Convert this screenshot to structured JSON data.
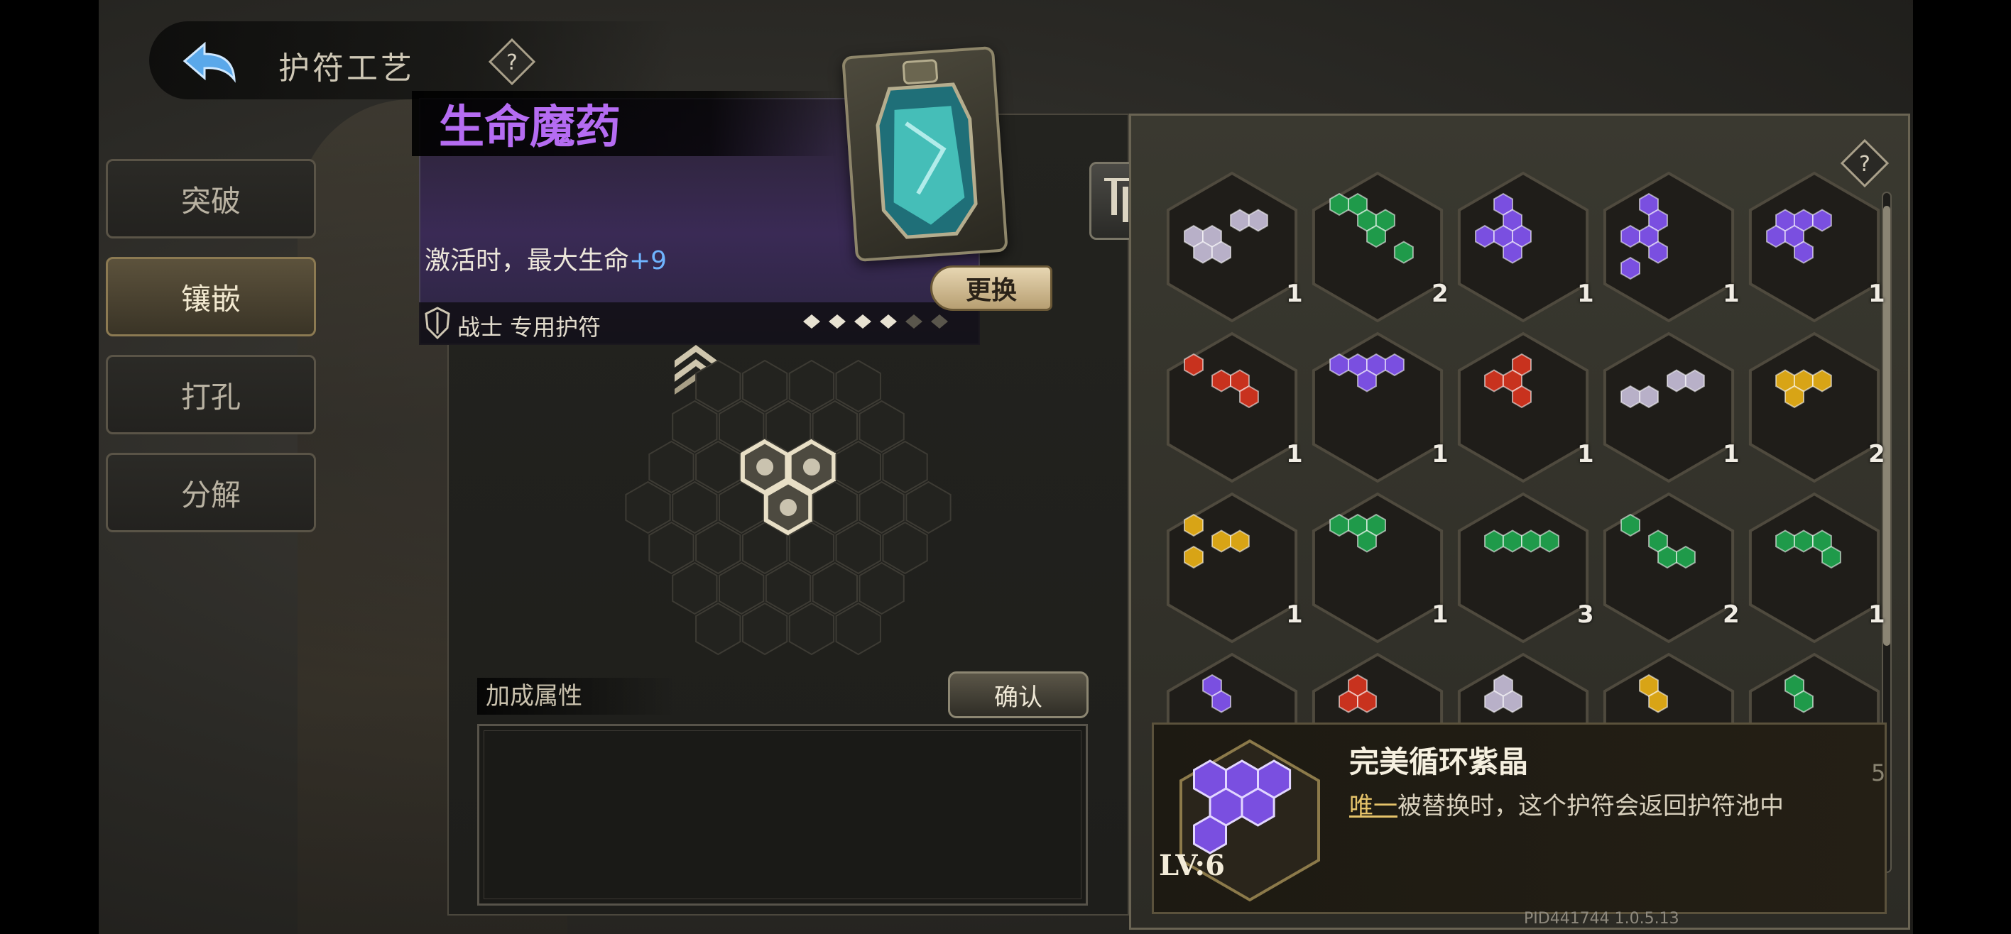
{
  "header": {
    "title": "护符工艺"
  },
  "tabs": [
    {
      "label": "突破",
      "active": false
    },
    {
      "label": "镶嵌",
      "active": true
    },
    {
      "label": "打孔",
      "active": false
    },
    {
      "label": "分解",
      "active": false
    }
  ],
  "charm": {
    "name": "生命魔药",
    "effect_prefix": "激活时，最大生命",
    "effect_bonus": "+9",
    "class_label": "战士 专用护符",
    "stars_filled": 4,
    "stars_total": 6,
    "swap_label": "更换"
  },
  "inlay": {
    "bonus_title": "加成属性",
    "confirm_label": "确认"
  },
  "colors": {
    "purple": "#7a4fe0",
    "green": "#1f9a4a",
    "red": "#c8321e",
    "yellow": "#d8a416",
    "silver": "#b8b0c8"
  },
  "inventory": [
    {
      "color": "silver",
      "count": "1"
    },
    {
      "color": "green",
      "count": "2"
    },
    {
      "color": "purple",
      "count": "1"
    },
    {
      "color": "purple",
      "count": "1"
    },
    {
      "color": "purple",
      "count": "1"
    },
    {
      "color": "red",
      "count": "1"
    },
    {
      "color": "purple",
      "count": "1"
    },
    {
      "color": "red",
      "count": "1"
    },
    {
      "color": "silver",
      "count": "1"
    },
    {
      "color": "yellow",
      "count": "2"
    },
    {
      "color": "yellow",
      "count": "1"
    },
    {
      "color": "green",
      "count": "1"
    },
    {
      "color": "green",
      "count": "3"
    },
    {
      "color": "green",
      "count": "2"
    },
    {
      "color": "green",
      "count": "1"
    },
    {
      "color": "purple",
      "count": ""
    },
    {
      "color": "red",
      "count": ""
    },
    {
      "color": "silver",
      "count": ""
    },
    {
      "color": "yellow",
      "count": ""
    },
    {
      "color": "green",
      "count": ""
    }
  ],
  "tooltip": {
    "level": "LV:6",
    "name": "完美循环紫晶",
    "keyword": "唯一",
    "description": "被替换时，这个护符会返回护符池中",
    "page": "5"
  },
  "version": "PID441744  1.0.5.13"
}
